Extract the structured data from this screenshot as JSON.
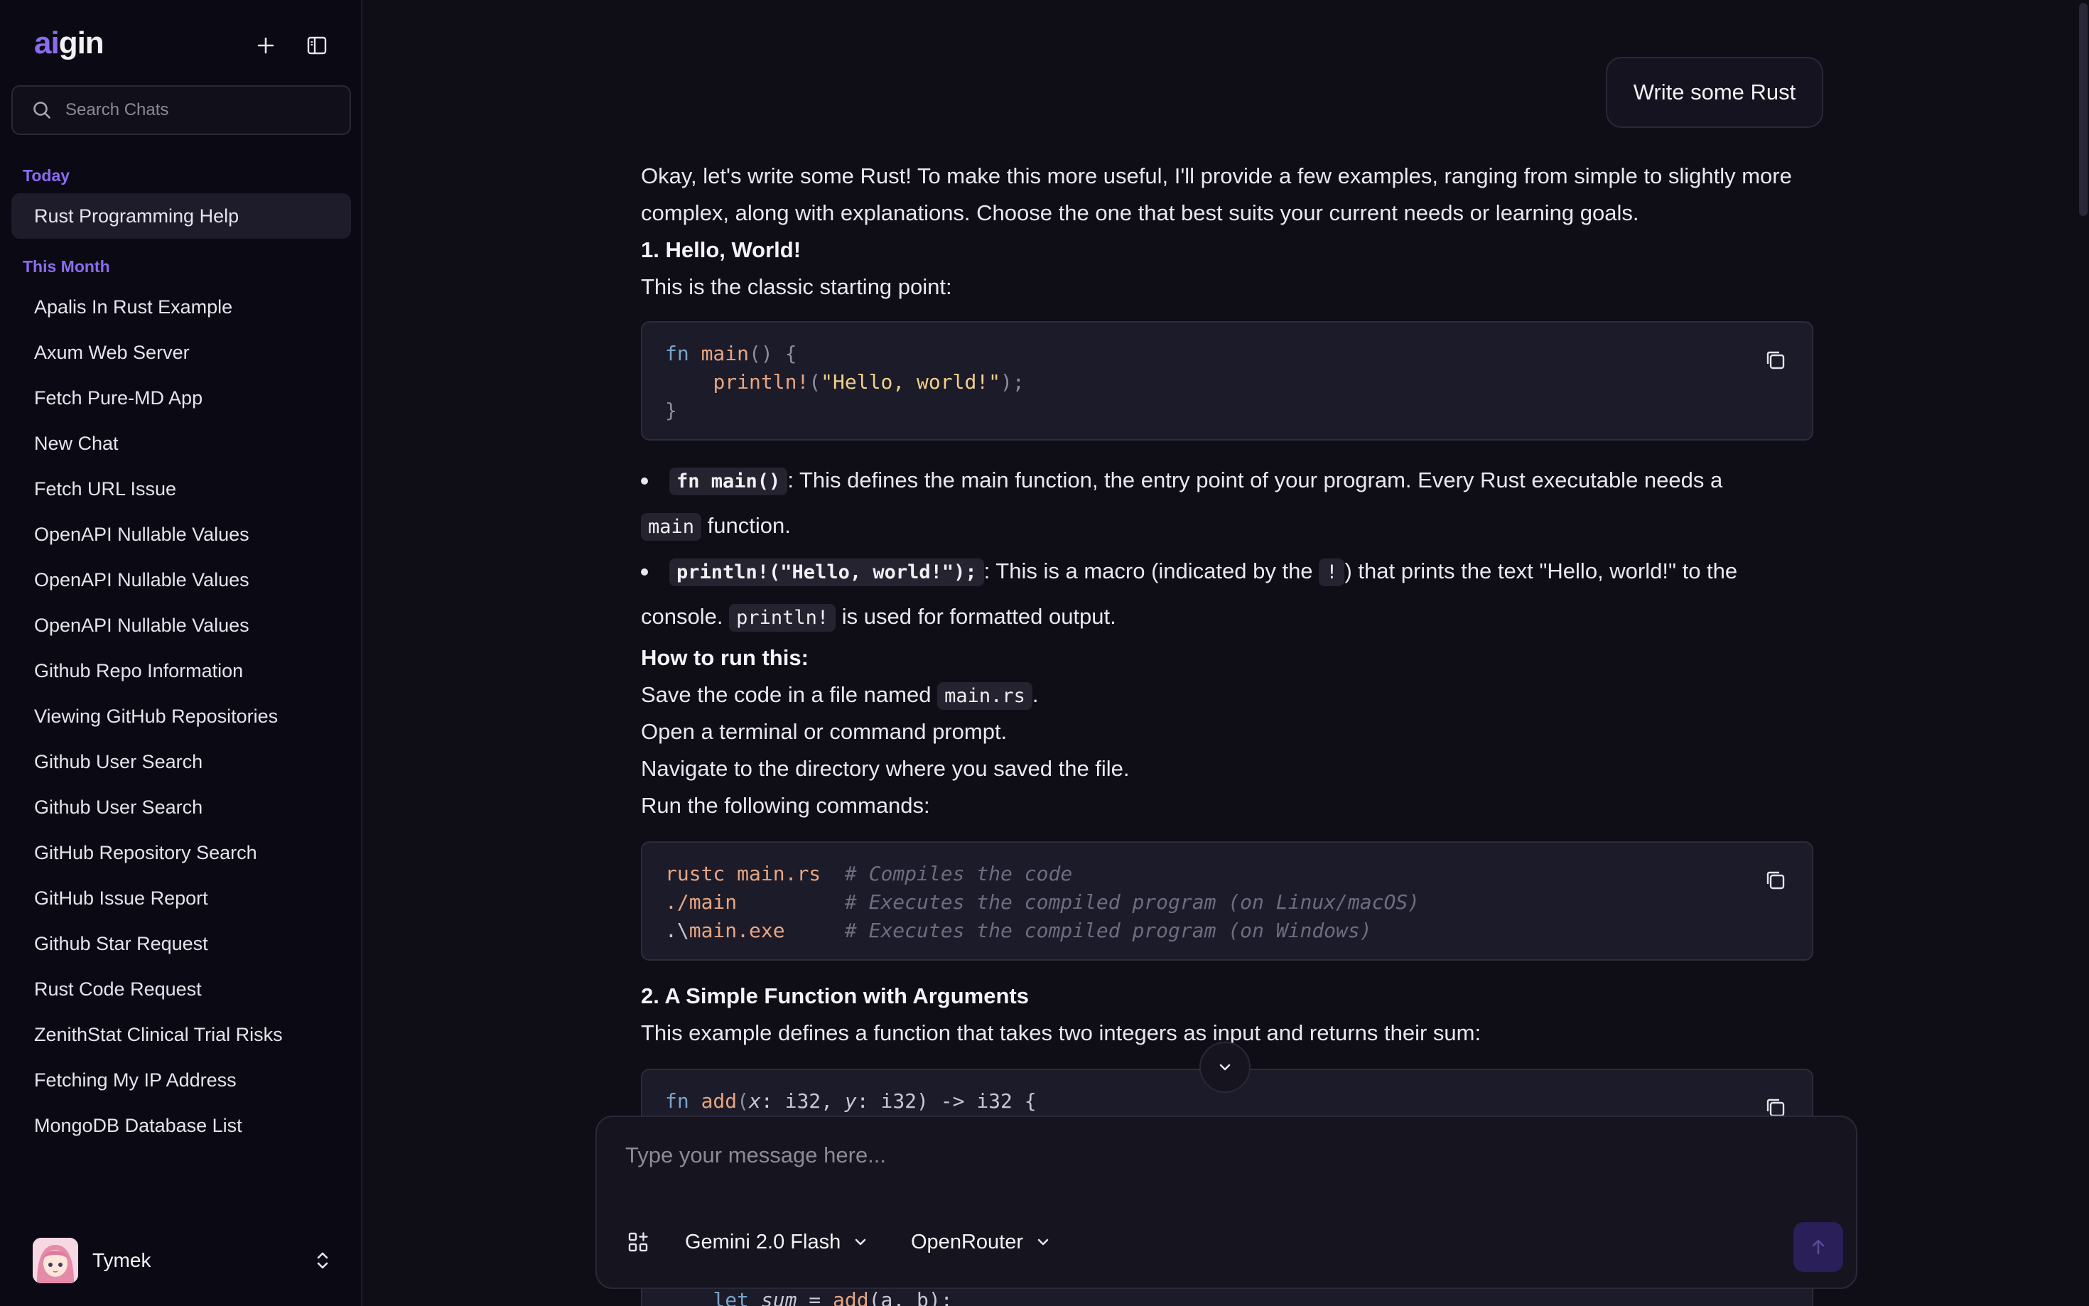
{
  "app": {
    "logo_ai": "ai",
    "logo_rest": "gin"
  },
  "sidebar": {
    "search_placeholder": "Search Chats",
    "today_label": "Today",
    "month_label": "This Month",
    "today_items": [
      "Rust Programming Help"
    ],
    "month_items": [
      "Apalis In Rust Example",
      "Axum Web Server",
      "Fetch Pure-MD App",
      "New Chat",
      "Fetch URL Issue",
      "OpenAPI Nullable Values",
      "OpenAPI Nullable Values",
      "OpenAPI Nullable Values",
      "Github Repo Information",
      "Viewing GitHub Repositories",
      "Github User Search",
      "Github User Search",
      "GitHub Repository Search",
      "GitHub Issue Report",
      "Github Star Request",
      "Rust Code Request",
      "ZenithStat Clinical Trial Risks",
      "Fetching My IP Address",
      "MongoDB Database List"
    ],
    "user_name": "Tymek"
  },
  "chat": {
    "user_message": "Write some Rust",
    "intro": "Okay, let's write some Rust! To make this more useful, I'll provide a few examples, ranging from simple to slightly more complex, along with explanations. Choose the one that best suits your current needs or learning goals.",
    "h1": "1. Hello, World!",
    "p1": "This is the classic starting point:",
    "b1_code": "fn main()",
    "b1_text_a": ": This defines the main function, the entry point of your program. Every Rust executable needs a",
    "b1_code2": "main",
    "b1_text_b": "function.",
    "b2_code": "println!(\"Hello, world!\");",
    "b2_text_a": ": This is a macro (indicated by the",
    "b2_code2": "!",
    "b2_text_b": ") that prints the text \"Hello, world!\" to the",
    "b2_text_c": "console.",
    "b2_code3": "println!",
    "b2_text_d": "is used for formatted output.",
    "h2": "How to run this:",
    "s1_a": "Save the code in a file named",
    "s1_code": "main.rs",
    "s1_b": ".",
    "s2": "Open a terminal or command prompt.",
    "s3": "Navigate to the directory where you saved the file.",
    "s4": "Run the following commands:",
    "h3": "2. A Simple Function with Arguments",
    "p3": "This example defines a function that takes two integers as input and returns their sum:",
    "code1": {
      "kw_fn": "fn",
      "name": "main",
      "open": "() {",
      "macro": "println!",
      "lp": "(",
      "str": "\"Hello, world!\"",
      "rp": ");",
      "close": "}"
    },
    "code2": {
      "l1_cmd": "rustc",
      "l1_arg": "main.rs",
      "l1_cmt": "# Compiles the code",
      "l2_cmd": "./main",
      "l2_cmt": "# Executes the compiled program (on Linux/macOS)",
      "l3_dot": ".\\",
      "l3_arg": "main.exe",
      "l3_cmt": "# Executes the compiled program (on Windows)"
    },
    "code3": {
      "kw_fn": "fn",
      "name": "add",
      "sig_a": "(",
      "x": "x",
      "sig_b": ": i32, ",
      "y": "y",
      "sig_c": ": i32) -> i32 {",
      "kw_let": "let",
      "sum": "sum",
      "eq": " = ",
      "call": "add",
      "args": "(a, b);"
    }
  },
  "composer": {
    "placeholder": "Type your message here...",
    "model": "Gemini 2.0 Flash",
    "provider": "OpenRouter"
  }
}
